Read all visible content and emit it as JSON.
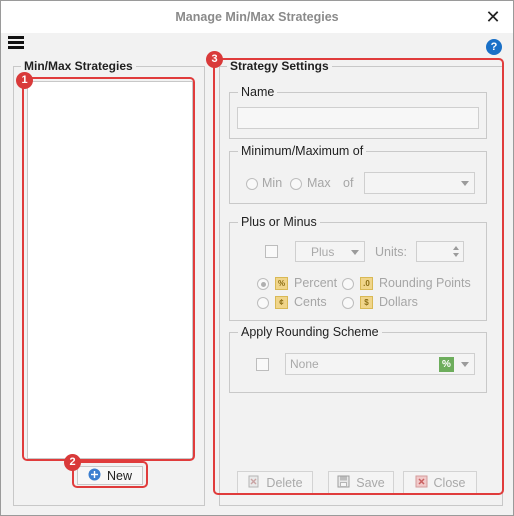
{
  "window": {
    "title": "Manage Min/Max Strategies",
    "close_symbol": "✕",
    "help_symbol": "?"
  },
  "strategies_panel": {
    "title": "Min/Max Strategies",
    "items": [],
    "new_button_label": "New"
  },
  "settings_panel": {
    "title": "Strategy Settings",
    "name": {
      "legend": "Name",
      "value": ""
    },
    "min_max": {
      "legend": "Minimum/Maximum of",
      "min_label": "Min",
      "max_label": "Max",
      "of_label": "of",
      "of_value": ""
    },
    "plus_minus": {
      "legend": "Plus or Minus",
      "enabled": false,
      "direction_value": "Plus",
      "units_label": "Units:",
      "units_value": "",
      "selected_mode": "Percent",
      "percent_label": "Percent",
      "rounding_points_label": "Rounding Points",
      "cents_label": "Cents",
      "dollars_label": "Dollars"
    },
    "rounding": {
      "legend": "Apply Rounding Scheme",
      "enabled": false,
      "scheme_value": "None"
    },
    "buttons": {
      "delete_label": "Delete",
      "save_label": "Save",
      "close_label": "Close"
    }
  },
  "annotations": [
    "1",
    "2",
    "3"
  ],
  "colors": {
    "annotation_red": "#e03c3c",
    "help_blue": "#1a70c7",
    "disabled_text": "#a9a9a9"
  }
}
